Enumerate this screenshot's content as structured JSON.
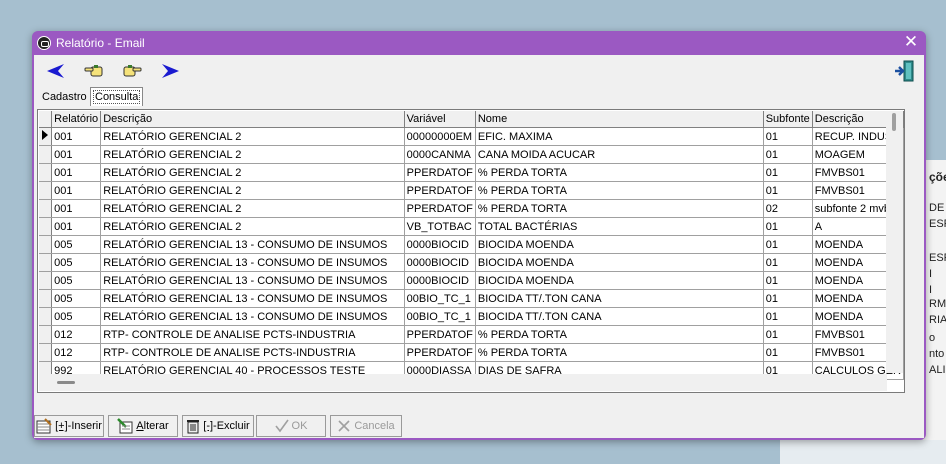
{
  "window": {
    "title": "Relatório - Email",
    "close_glyph": "✕"
  },
  "toolbar": {
    "buttons": [
      {
        "name": "first-record-button",
        "icon": "arrow-left-icon",
        "color": "#1a1ad0"
      },
      {
        "name": "previous-record-button",
        "icon": "hand-pointing-left-icon"
      },
      {
        "name": "next-record-button",
        "icon": "hand-pointing-right-icon"
      },
      {
        "name": "last-record-button",
        "icon": "arrow-right-icon",
        "color": "#1a1ad0"
      },
      {
        "name": "exit-button",
        "icon": "exit-door-icon"
      }
    ]
  },
  "tabs": {
    "cadastro": "Cadastro",
    "consulta": "Consulta",
    "active": "Consulta"
  },
  "grid": {
    "columns": [
      "Relatório",
      "Descrição",
      "Variável",
      "Nome",
      "Subfonte",
      "Descrição"
    ],
    "rows": [
      [
        "001",
        "RELATÓRIO GERENCIAL 2",
        "00000000EM",
        "EFIC. MAXIMA",
        "01",
        "RECUP. INDUST"
      ],
      [
        "001",
        "RELATÓRIO GERENCIAL 2",
        "0000CANMA",
        "CANA MOIDA ACUCAR",
        "01",
        "MOAGEM"
      ],
      [
        "001",
        "RELATÓRIO GERENCIAL 2",
        "PPERDATOF",
        "% PERDA TORTA",
        "01",
        "FMVBS01"
      ],
      [
        "001",
        "RELATÓRIO GERENCIAL 2",
        "PPERDATOF",
        "% PERDA TORTA",
        "01",
        "FMVBS01"
      ],
      [
        "001",
        "RELATÓRIO GERENCIAL 2",
        "PPERDATOF",
        "% PERDA TORTA",
        "02",
        "subfonte 2 mvb"
      ],
      [
        "001",
        "RELATÓRIO GERENCIAL 2",
        "VB_TOTBAC",
        "TOTAL BACTÉRIAS",
        "01",
        "A"
      ],
      [
        "005",
        "RELATÓRIO GERENCIAL 13 - CONSUMO DE INSUMOS",
        "0000BIOCID",
        "BIOCIDA MOENDA",
        "01",
        "MOENDA"
      ],
      [
        "005",
        "RELATÓRIO GERENCIAL 13 - CONSUMO DE INSUMOS",
        "0000BIOCID",
        "BIOCIDA MOENDA",
        "01",
        "MOENDA"
      ],
      [
        "005",
        "RELATÓRIO GERENCIAL 13 - CONSUMO DE INSUMOS",
        "0000BIOCID",
        "BIOCIDA MOENDA",
        "01",
        "MOENDA"
      ],
      [
        "005",
        "RELATÓRIO GERENCIAL 13 - CONSUMO DE INSUMOS",
        "00BIO_TC_1",
        "BIOCIDA TT/.TON CANA",
        "01",
        "MOENDA"
      ],
      [
        "005",
        "RELATÓRIO GERENCIAL 13 - CONSUMO DE INSUMOS",
        "00BIO_TC_1",
        "BIOCIDA TT/.TON CANA",
        "01",
        "MOENDA"
      ],
      [
        "012",
        "RTP- CONTROLE DE ANALISE PCTS-INDUSTRIA",
        "PPERDATOF",
        "% PERDA TORTA",
        "01",
        "FMVBS01"
      ],
      [
        "012",
        "RTP- CONTROLE DE ANALISE PCTS-INDUSTRIA",
        "PPERDATOF",
        "% PERDA TORTA",
        "01",
        "FMVBS01"
      ],
      [
        "992",
        "RELATÓRIO GERENCIAL 40 - PROCESSOS TESTE",
        "0000DIASSA",
        "DIAS DE SAFRA",
        "01",
        "CALCULOS GER"
      ]
    ]
  },
  "actions": {
    "inserir": {
      "shortcut": "[+]",
      "label": "-Inserir",
      "enabled": true
    },
    "alterar": {
      "shortcut": "A",
      "label": "lterar",
      "enabled": true
    },
    "excluir": {
      "shortcut": "[-]",
      "label": "-Excluir",
      "enabled": true
    },
    "ok": {
      "label": "OK",
      "enabled": false
    },
    "cancela": {
      "label": "Cancela",
      "enabled": false
    }
  },
  "background_window": {
    "lines": [
      "ções",
      "DE A",
      "ESFR",
      "ESFR",
      "I",
      "I",
      "RM",
      "RIA",
      "o",
      "nto",
      "ALID"
    ]
  }
}
